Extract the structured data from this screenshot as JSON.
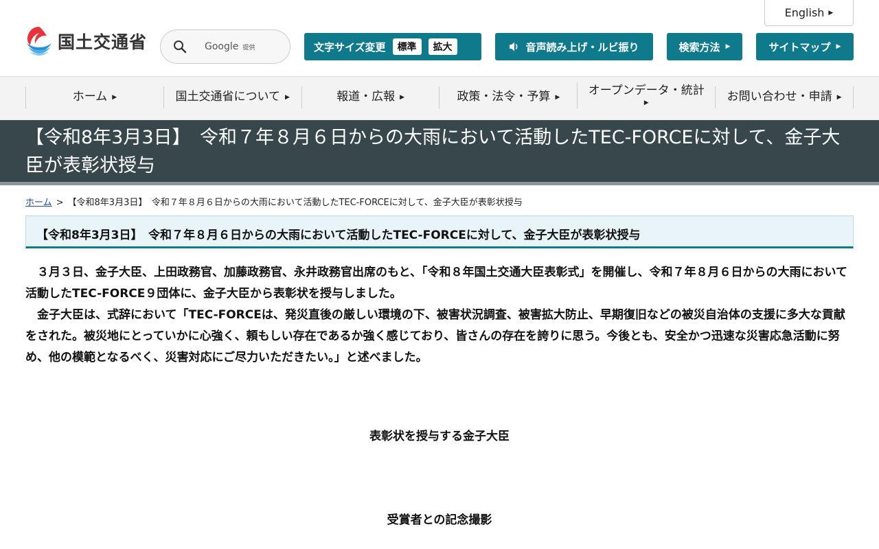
{
  "header": {
    "english_label": "English",
    "logo_text": "国土交通省",
    "search": {
      "brand": "Google",
      "provided": "提供",
      "placeholder": "Google 提供"
    },
    "font_size": {
      "label": "文字サイズ変更",
      "standard": "標準",
      "large": "拡大"
    },
    "voice_label": "音声読み上げ・ルビ振り",
    "howto_label": "検索方法",
    "sitemap_label": "サイトマップ"
  },
  "gnav": {
    "items": [
      {
        "label": "ホーム"
      },
      {
        "label": "国土交通省について"
      },
      {
        "label": "報道・広報"
      },
      {
        "label": "政策・法令・予算"
      },
      {
        "label": "オープンデータ・統計"
      },
      {
        "label": "お問い合わせ・申請"
      }
    ]
  },
  "page": {
    "title": "【令和8年3月3日】　令和７年８月６日からの大雨において活動したTEC-FORCEに対して、金子大臣が表彰状授与",
    "breadcrumb": {
      "home": "ホーム",
      "separator": ">",
      "current": "【令和8年3月3日】　令和７年８月６日からの大雨において活動したTEC-FORCEに対して、金子大臣が表彰状授与"
    },
    "heading": "【令和8年3月3日】　令和７年８月６日からの大雨において活動したTEC-FORCEに対して、金子大臣が表彰状授与",
    "paragraphs": [
      "３月３日、金子大臣、上田政務官、加藤政務官、永井政務官出席のもと、「令和８年国土交通大臣表彰式」を開催し、令和７年８月６日からの大雨において活動したTEC-FORCE９団体に、金子大臣から表彰状を授与しました。",
      "金子大臣は、式辞において「TEC-FORCEは、発災直後の厳しい環境の下、被害状況調査、被害拡大防止、早期復旧などの被災自治体の支援に多大な貢献をされた。被災地にとっていかに心強く、頼もしい存在であるか強く感じており、皆さんの存在を誇りに思う。今後とも、安全かつ迅速な災害応急活動に努め、他の模範となるべく、災害対応にご尽力いただきたい。」と述べました。"
    ],
    "captions": [
      "表彰状を授与する金子大臣",
      "受賞者との記念撮影"
    ]
  },
  "colors": {
    "accent": "#0f7a8c",
    "title_band": "#37474c",
    "heading_bg": "#e8f4f8",
    "link": "#1a4b9c"
  },
  "icons": [
    "mlit-logo-icon",
    "search-icon",
    "speaker-icon",
    "triangle-right-icon"
  ]
}
